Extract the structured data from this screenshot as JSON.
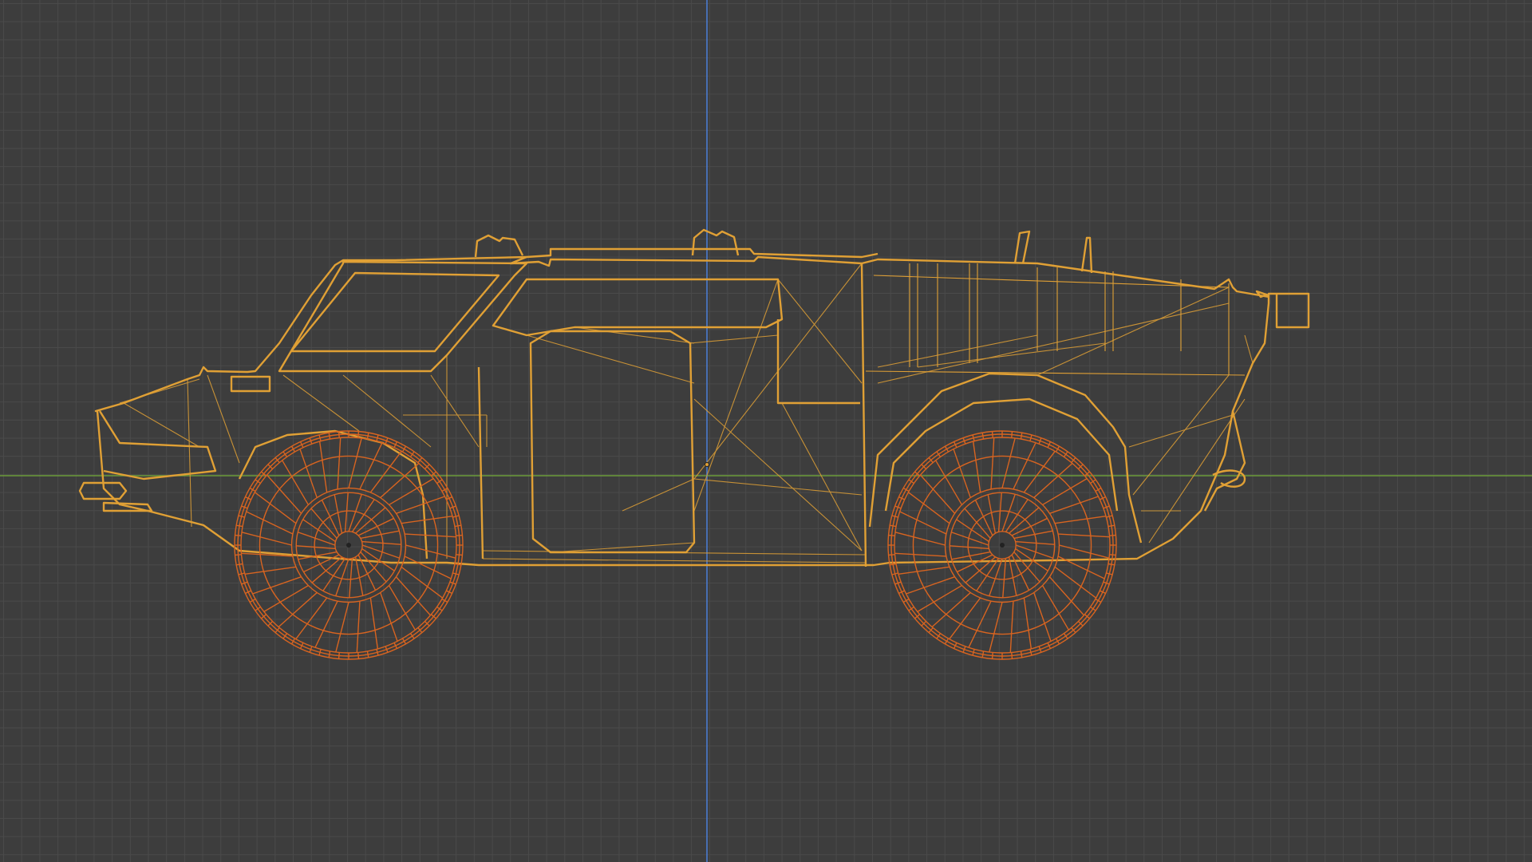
{
  "viewport": {
    "view": "side-orthographic",
    "shading": "wireframe",
    "background_color": "#3d3d3d",
    "grid_color": "#4a4a4a",
    "x_axis_color": "#6c9b3a",
    "z_axis_color": "#4a7bd0"
  },
  "objects": [
    {
      "name": "vehicle-body",
      "state": "selected",
      "wire_color": "#e0a035"
    },
    {
      "name": "wheel-front",
      "state": "active",
      "wire_color": "#d86420"
    },
    {
      "name": "wheel-rear",
      "state": "active",
      "wire_color": "#d86420"
    }
  ]
}
